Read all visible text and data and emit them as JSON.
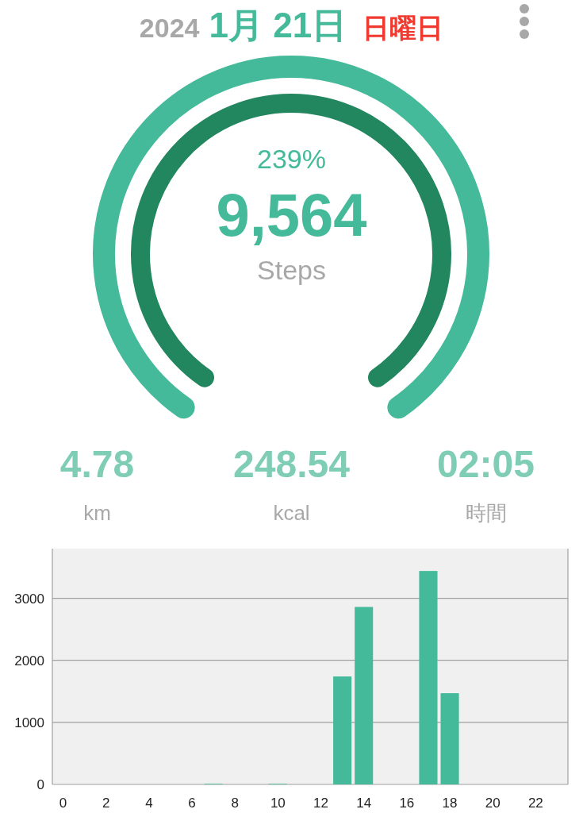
{
  "header": {
    "year": "2024",
    "date": "1月 21日",
    "weekday": "日曜日"
  },
  "summary": {
    "percent": "239%",
    "steps": "9,564",
    "unit": "Steps"
  },
  "stats": [
    {
      "value": "4.78",
      "label": "km"
    },
    {
      "value": "248.54",
      "label": "kcal"
    },
    {
      "value": "02:05",
      "label": "時間"
    }
  ],
  "chart_data": {
    "type": "bar",
    "x": [
      0,
      1,
      2,
      3,
      4,
      5,
      6,
      7,
      8,
      9,
      10,
      11,
      12,
      13,
      14,
      15,
      16,
      17,
      18,
      19,
      20,
      21,
      22,
      23
    ],
    "grid": true,
    "series": [
      {
        "color": "#45ba9a",
        "values": [
          0,
          0,
          0,
          0,
          0,
          0,
          0,
          10,
          0,
          0,
          10,
          0,
          0,
          1740,
          2860,
          0,
          0,
          3440,
          1470,
          0,
          0,
          0,
          0,
          0
        ]
      }
    ],
    "xlim": [
      -0.5,
      23.5
    ],
    "ylim": [
      0,
      3800
    ],
    "yticks": [
      0,
      1000,
      2000,
      3000
    ],
    "xticks": [
      0,
      2,
      4,
      6,
      8,
      10,
      12,
      14,
      16,
      18,
      20,
      22
    ]
  }
}
